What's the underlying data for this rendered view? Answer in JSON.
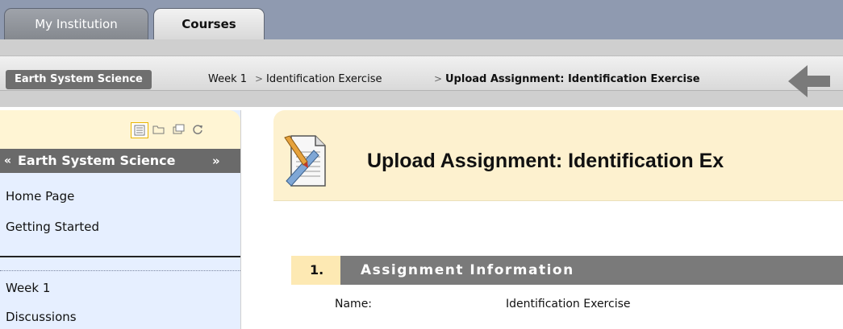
{
  "tabs": [
    {
      "label": "My Institution",
      "active": false
    },
    {
      "label": "Courses",
      "active": true
    }
  ],
  "breadcrumb": {
    "course": "Earth System Science",
    "items": [
      "Week 1",
      "Identification Exercise",
      "Upload Assignment: Identification Exercise"
    ],
    "separator": ">"
  },
  "sidebar": {
    "tools": [
      "list-view-icon",
      "folder-view-icon",
      "window-view-icon",
      "refresh-icon"
    ],
    "collapse_glyph": "«",
    "expand_glyph": "»",
    "course_title": "Earth System Science",
    "menu_top": [
      "Home Page",
      "Getting Started"
    ],
    "menu_bottom": [
      "Week 1",
      "Discussions"
    ]
  },
  "page": {
    "title": "Upload Assignment: Identification Ex",
    "section_number": "1.",
    "section_title": "Assignment Information",
    "fields": [
      {
        "label": "Name:",
        "value": "Identification Exercise"
      }
    ]
  },
  "colors": {
    "tabbar": "#8f9ab0",
    "sidebar_bg": "#e6efff",
    "header_bg": "#fdf1cf",
    "section_bar": "#7a7a7a",
    "section_number_bg": "#fde9b3"
  }
}
